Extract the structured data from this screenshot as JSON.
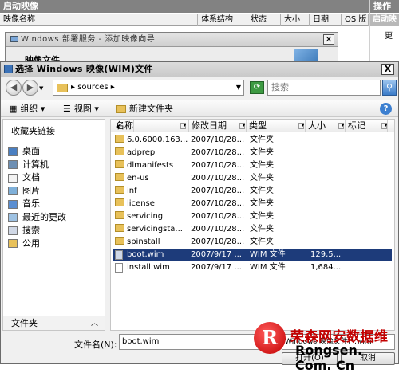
{
  "background": {
    "title": "启动映像",
    "columns": [
      "映像名称",
      "体系结构",
      "状态",
      "大小",
      "日期",
      "OS 版"
    ],
    "right_title": "操作",
    "right_sub": "启动映",
    "right_item": "更"
  },
  "wizard": {
    "title": "Windows 部署服务 - 添加映像向导",
    "subtitle": "映像文件"
  },
  "dialog": {
    "title": "选择 Windows 映像(WIM)文件",
    "close": "X",
    "address": "sources",
    "search_placeholder": "搜索",
    "toolbar": {
      "organize": "组织",
      "views": "视图",
      "new_folder": "新建文件夹"
    },
    "favorites_header": "收藏夹链接",
    "favorites": [
      "桌面",
      "计算机",
      "文档",
      "图片",
      "音乐",
      "最近的更改",
      "搜索",
      "公用"
    ],
    "folders_label": "文件夹",
    "columns": {
      "name": "名称",
      "date": "修改日期",
      "type": "类型",
      "size": "大小",
      "tags": "标记"
    },
    "files": [
      {
        "name": "6.0.6000.163...",
        "date": "2007/10/28...",
        "type": "文件夹",
        "size": "",
        "kind": "folder"
      },
      {
        "name": "adprep",
        "date": "2007/10/28...",
        "type": "文件夹",
        "size": "",
        "kind": "folder"
      },
      {
        "name": "dlmanifests",
        "date": "2007/10/28...",
        "type": "文件夹",
        "size": "",
        "kind": "folder"
      },
      {
        "name": "en-us",
        "date": "2007/10/28...",
        "type": "文件夹",
        "size": "",
        "kind": "folder"
      },
      {
        "name": "inf",
        "date": "2007/10/28...",
        "type": "文件夹",
        "size": "",
        "kind": "folder"
      },
      {
        "name": "license",
        "date": "2007/10/28...",
        "type": "文件夹",
        "size": "",
        "kind": "folder"
      },
      {
        "name": "servicing",
        "date": "2007/10/28...",
        "type": "文件夹",
        "size": "",
        "kind": "folder"
      },
      {
        "name": "servicingsta...",
        "date": "2007/10/28...",
        "type": "文件夹",
        "size": "",
        "kind": "folder"
      },
      {
        "name": "spinstall",
        "date": "2007/10/28...",
        "type": "文件夹",
        "size": "",
        "kind": "folder"
      },
      {
        "name": "boot.wim",
        "date": "2007/9/17 ...",
        "type": "WIM 文件",
        "size": "129,5...",
        "kind": "file",
        "selected": true
      },
      {
        "name": "install.wim",
        "date": "2007/9/17 ...",
        "type": "WIM 文件",
        "size": "1,684...",
        "kind": "file"
      }
    ],
    "filename_label": "文件名(N):",
    "filename_value": "boot.wim",
    "filetype_value": "Windows 映像文件(*.wim)",
    "open_label": "打开(O)",
    "cancel_label": "取消"
  },
  "watermark": {
    "logo": "R",
    "cn": "荣森网安数据维",
    "en": "Rongsen. Com. Cn"
  }
}
